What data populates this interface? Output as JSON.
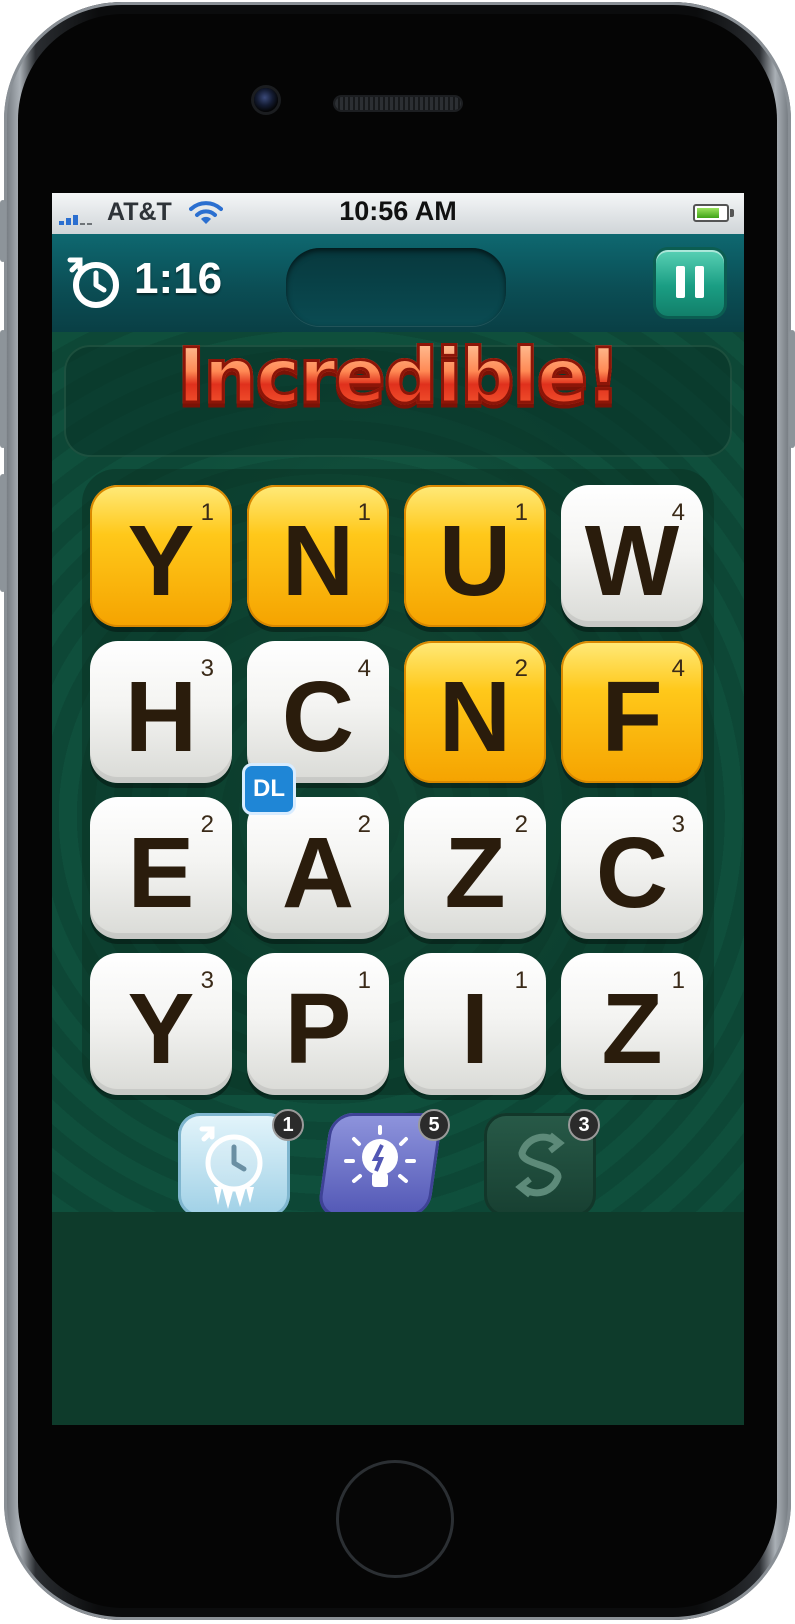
{
  "status_bar": {
    "carrier": "AT&T",
    "time": "10:56 AM"
  },
  "game": {
    "timer": "1:16",
    "banner": "Incredible!",
    "tiles": [
      {
        "letter": "Y",
        "points": "1",
        "selected": true
      },
      {
        "letter": "N",
        "points": "1",
        "selected": true
      },
      {
        "letter": "U",
        "points": "1",
        "selected": true
      },
      {
        "letter": "W",
        "points": "4",
        "selected": false
      },
      {
        "letter": "H",
        "points": "3",
        "selected": false
      },
      {
        "letter": "C",
        "points": "4",
        "selected": false
      },
      {
        "letter": "N",
        "points": "2",
        "selected": true
      },
      {
        "letter": "F",
        "points": "4",
        "selected": true
      },
      {
        "letter": "E",
        "points": "2",
        "selected": false
      },
      {
        "letter": "A",
        "points": "2",
        "selected": false,
        "bonus": "DL"
      },
      {
        "letter": "Z",
        "points": "2",
        "selected": false
      },
      {
        "letter": "C",
        "points": "3",
        "selected": false
      },
      {
        "letter": "Y",
        "points": "3",
        "selected": false
      },
      {
        "letter": "P",
        "points": "1",
        "selected": false
      },
      {
        "letter": "I",
        "points": "1",
        "selected": false
      },
      {
        "letter": "Z",
        "points": "1",
        "selected": false
      }
    ],
    "powerups": [
      {
        "name": "freeze-timer",
        "icon": "frozen-clock-icon",
        "count": "1",
        "color": "#bfe3f2"
      },
      {
        "name": "hint",
        "icon": "lightbulb-icon",
        "count": "5",
        "color": "#6f73c9"
      },
      {
        "name": "shuffle",
        "icon": "shuffle-icon",
        "count": "3",
        "color": "#1f4a3b"
      }
    ]
  },
  "colors": {
    "gold_tile": "#ffc81a",
    "white_tile": "#f4f4f2",
    "board": "#0e3b2b",
    "topbar": "#0b4e55",
    "pause": "#1a9d83"
  }
}
